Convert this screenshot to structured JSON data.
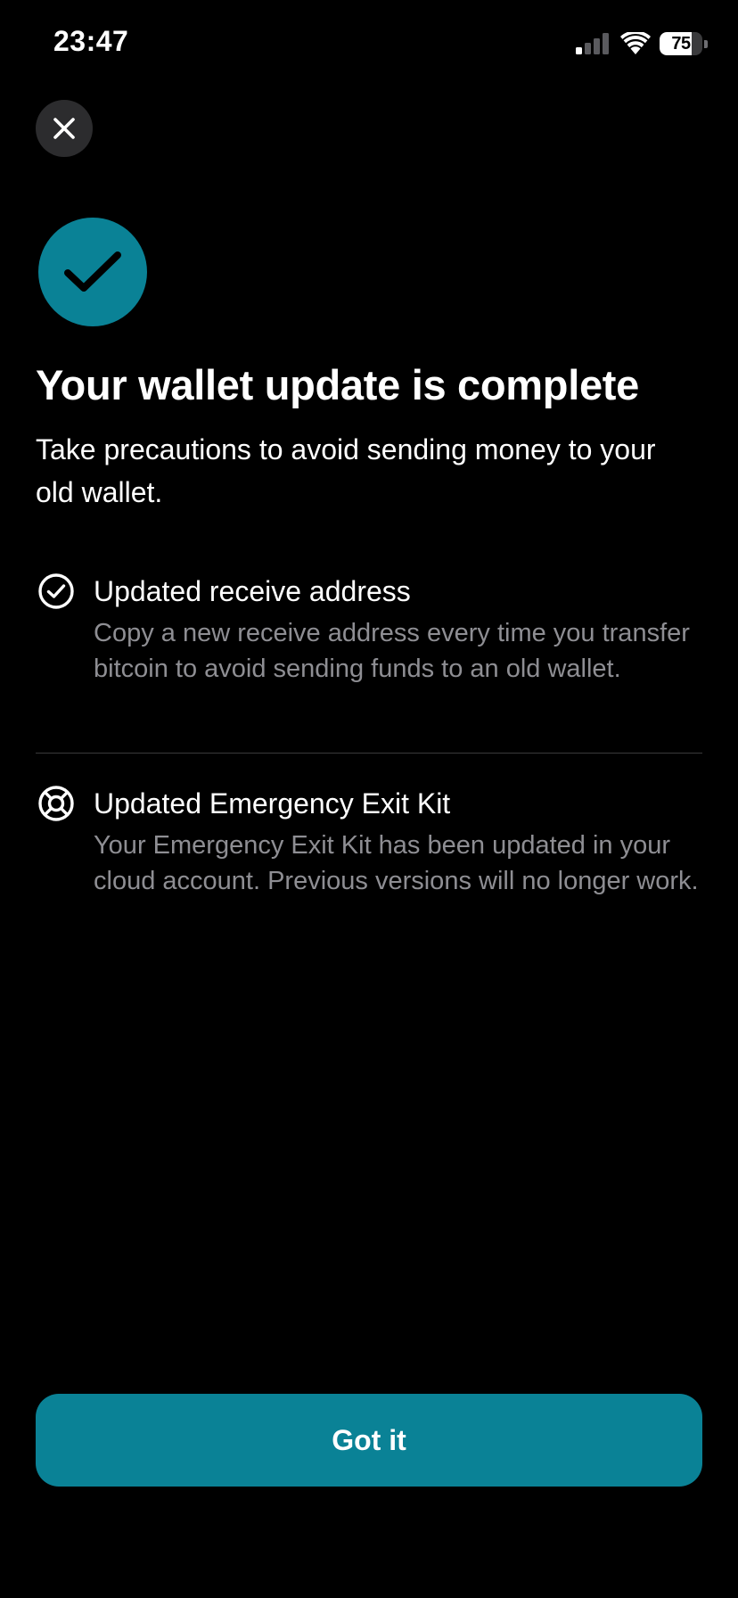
{
  "status_bar": {
    "time": "23:47",
    "battery_level": "75",
    "battery_fraction": 0.75,
    "signal_bars_active": 1,
    "signal_bars_total": 4,
    "icons": [
      "signal-icon",
      "wifi-icon",
      "battery-icon"
    ]
  },
  "close_button": {
    "icon": "close-icon"
  },
  "badge": {
    "icon": "checkmark-icon",
    "color": "#0a8296"
  },
  "title": "Your wallet update is complete",
  "subtitle": "Take precautions to avoid sending money to your old wallet.",
  "items": [
    {
      "icon": "check-circle-icon",
      "title": "Updated receive address",
      "description": "Copy a new receive address every time you transfer bitcoin to avoid sending funds to an old wallet."
    },
    {
      "icon": "lifebuoy-icon",
      "title": "Updated Emergency Exit Kit",
      "description": "Your Emergency Exit Kit has been updated in your cloud account. Previous versions will no longer work."
    }
  ],
  "primary_button": {
    "label": "Got it",
    "color": "#0a8296"
  },
  "colors": {
    "background": "#000000",
    "accent": "#0a8296",
    "text_primary": "#ffffff",
    "text_secondary": "#8e8e93",
    "divider": "#3a3a3c"
  }
}
